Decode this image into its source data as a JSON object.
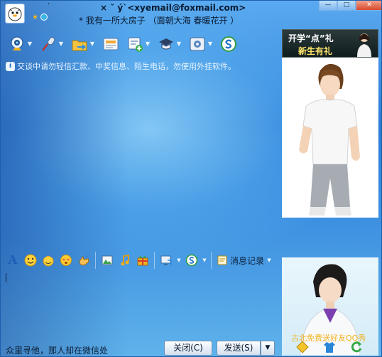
{
  "window": {
    "contact_name": "× ˇ ý`<xyemail@foxmail.com>",
    "signature": "*  我有一所大房子    （面朝大海     春暖花开 ）",
    "controls": [
      "—",
      "□",
      "✕"
    ]
  },
  "toolbar": {
    "items": [
      {
        "icon": "webcam-icon",
        "has_menu": true
      },
      {
        "icon": "microphone-icon",
        "has_menu": true
      },
      {
        "icon": "folder-icon",
        "has_menu": true
      },
      {
        "icon": "mail-icon",
        "has_menu": false
      },
      {
        "icon": "add-note-icon",
        "has_menu": true
      },
      {
        "icon": "graduation-cap-icon",
        "has_menu": true
      },
      {
        "icon": "settings-icon",
        "has_menu": true
      },
      {
        "icon": "soso-icon",
        "has_menu": false
      }
    ]
  },
  "notice": {
    "text": "交谈中请勿轻信汇款、中奖信息、陌生电话，勿使用外挂软件。"
  },
  "ad": {
    "line1": "开学“点”礼",
    "line2": "新生有礼"
  },
  "input_toolbar": {
    "font_label": "A",
    "history_label": "消息记录"
  },
  "input": {
    "value": ""
  },
  "promo": {
    "text": "古北免费送好友QQ秀"
  },
  "bottom": {
    "signature": "众里寻他，那人却在微信处",
    "close_label": "关闭(C)",
    "send_label": "发送(S)",
    "send_arrow": "▼"
  }
}
